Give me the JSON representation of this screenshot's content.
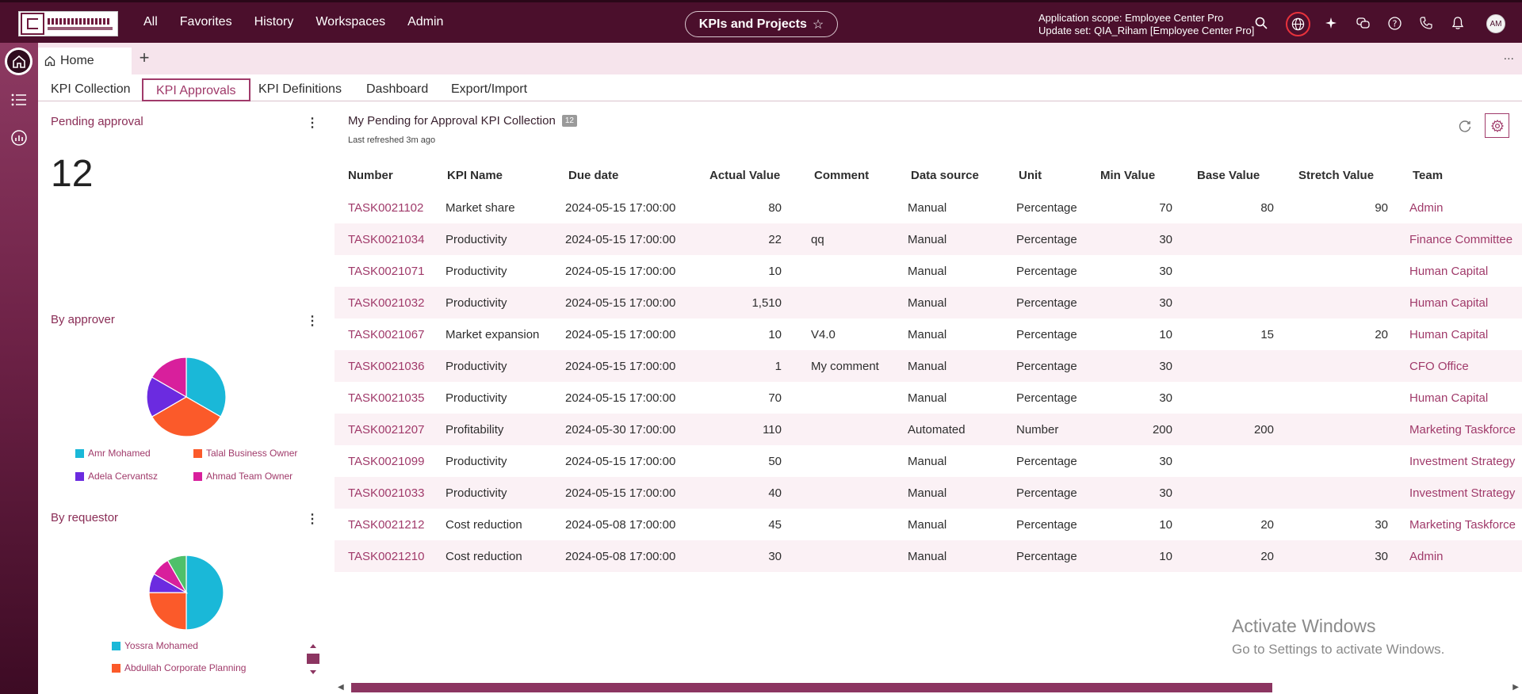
{
  "header": {
    "logo_text_en": "QATAR INVESTMENT AUTHORITY",
    "logo_text_ar": "جهاز قطر للاستثمار",
    "nav": [
      "All",
      "Favorites",
      "History",
      "Workspaces",
      "Admin"
    ],
    "title": "KPIs and Projects",
    "scope_line1": "Application scope: Employee Center Pro",
    "scope_line2": "Update set: QIA_Riham [Employee Center Pro]",
    "avatar_initials": "AM",
    "icons": [
      "search-icon",
      "globe-icon",
      "sparkle-icon",
      "chat-icon",
      "help-icon",
      "phone-icon",
      "bell-icon"
    ]
  },
  "tabs": {
    "home_label": "Home",
    "add_label": "+",
    "more_label": "..."
  },
  "subnav": [
    "KPI Collection",
    "KPI Approvals",
    "KPI Definitions",
    "Dashboard",
    "Export/Import"
  ],
  "subnav_active": "KPI Approvals",
  "left": {
    "pending": {
      "title": "Pending approval",
      "value": "12"
    },
    "approver": {
      "title": "By approver",
      "legend": [
        {
          "label": "Amr Mohamed",
          "color": "#1ab8d8"
        },
        {
          "label": "Talal Business Owner",
          "color": "#fb5a2a"
        },
        {
          "label": "Adela Cervantsz",
          "color": "#6b2be0"
        },
        {
          "label": "Ahmad Team Owner",
          "color": "#d81f9c"
        }
      ]
    },
    "requestor": {
      "title": "By requestor",
      "legend": [
        {
          "label": "Yossra Mohamed",
          "color": "#1ab8d8"
        },
        {
          "label": "Abdullah Corporate Planning",
          "color": "#fb5a2a"
        }
      ]
    }
  },
  "chart_data": [
    {
      "type": "pie",
      "title": "By approver",
      "series": [
        {
          "name": "Amr Mohamed",
          "value": 4,
          "color": "#1ab8d8"
        },
        {
          "name": "Talal Business Owner",
          "value": 4,
          "color": "#fb5a2a"
        },
        {
          "name": "Adela Cervantsz",
          "value": 2,
          "color": "#6b2be0"
        },
        {
          "name": "Ahmad Team Owner",
          "value": 2,
          "color": "#d81f9c"
        }
      ]
    },
    {
      "type": "pie",
      "title": "By requestor",
      "series": [
        {
          "name": "Yossra Mohamed",
          "value": 6,
          "color": "#1ab8d8"
        },
        {
          "name": "Abdullah Corporate Planning",
          "value": 3,
          "color": "#fb5a2a"
        },
        {
          "name": "",
          "value": 1,
          "color": "#6b2be0"
        },
        {
          "name": "",
          "value": 1,
          "color": "#d81f9c"
        },
        {
          "name": "",
          "value": 1,
          "color": "#4fc06a"
        }
      ]
    }
  ],
  "main": {
    "title": "My Pending for Approval KPI Collection",
    "count": "12",
    "last_refreshed": "Last refreshed 3m ago",
    "columns": [
      "Number",
      "KPI Name",
      "Due date",
      "Actual Value",
      "Comment",
      "Data source",
      "Unit",
      "Min Value",
      "Base Value",
      "Stretch Value",
      "Team"
    ],
    "rows": [
      [
        "TASK0021102",
        "Market share",
        "2024-05-15 17:00:00",
        "80",
        "",
        "Manual",
        "Percentage",
        "70",
        "80",
        "90",
        "Admin"
      ],
      [
        "TASK0021034",
        "Productivity",
        "2024-05-15 17:00:00",
        "22",
        "qq",
        "Manual",
        "Percentage",
        "30",
        "",
        "",
        "Finance Committee"
      ],
      [
        "TASK0021071",
        "Productivity",
        "2024-05-15 17:00:00",
        "10",
        "",
        "Manual",
        "Percentage",
        "30",
        "",
        "",
        "Human Capital"
      ],
      [
        "TASK0021032",
        "Productivity",
        "2024-05-15 17:00:00",
        "1,510",
        "",
        "Manual",
        "Percentage",
        "30",
        "",
        "",
        "Human Capital"
      ],
      [
        "TASK0021067",
        "Market expansion",
        "2024-05-15 17:00:00",
        "10",
        "V4.0",
        "Manual",
        "Percentage",
        "10",
        "15",
        "20",
        "Human Capital"
      ],
      [
        "TASK0021036",
        "Productivity",
        "2024-05-15 17:00:00",
        "1",
        "My comment",
        "Manual",
        "Percentage",
        "30",
        "",
        "",
        "CFO Office"
      ],
      [
        "TASK0021035",
        "Productivity",
        "2024-05-15 17:00:00",
        "70",
        "",
        "Manual",
        "Percentage",
        "30",
        "",
        "",
        "Human Capital"
      ],
      [
        "TASK0021207",
        "Profitability",
        "2024-05-30 17:00:00",
        "110",
        "",
        "Automated",
        "Number",
        "200",
        "200",
        "",
        "Marketing Taskforce"
      ],
      [
        "TASK0021099",
        "Productivity",
        "2024-05-15 17:00:00",
        "50",
        "",
        "Manual",
        "Percentage",
        "30",
        "",
        "",
        "Investment Strategy"
      ],
      [
        "TASK0021033",
        "Productivity",
        "2024-05-15 17:00:00",
        "40",
        "",
        "Manual",
        "Percentage",
        "30",
        "",
        "",
        "Investment Strategy"
      ],
      [
        "TASK0021212",
        "Cost reduction",
        "2024-05-08 17:00:00",
        "45",
        "",
        "Manual",
        "Percentage",
        "10",
        "20",
        "30",
        "Marketing Taskforce"
      ],
      [
        "TASK0021210",
        "Cost reduction",
        "2024-05-08 17:00:00",
        "30",
        "",
        "Manual",
        "Percentage",
        "10",
        "20",
        "30",
        "Admin"
      ]
    ]
  },
  "watermark": {
    "line1": "Activate Windows",
    "line2": "Go to Settings to activate Windows."
  },
  "colors": {
    "brand": "#4b0f2c",
    "accent": "#a03a6a"
  }
}
